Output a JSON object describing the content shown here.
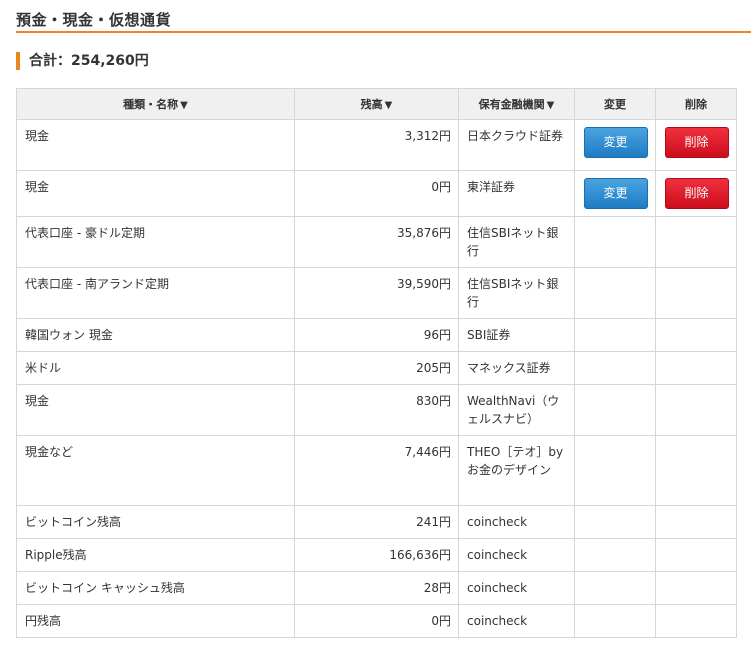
{
  "section": {
    "title": "預金・現金・仮想通貨"
  },
  "total": {
    "label": "合計：254,260円"
  },
  "table": {
    "headers": {
      "name": "種類・名称",
      "balance": "残高",
      "institution": "保有金融機関",
      "change": "変更",
      "delete": "削除"
    },
    "sort_arrow": "▼",
    "edit_label": "変更",
    "delete_label": "削除",
    "rows": [
      {
        "name": "現金",
        "balance": "3,312円",
        "institution": "日本クラウド証券",
        "editable": true
      },
      {
        "name": "現金",
        "balance": "0円",
        "institution": "東洋証券",
        "editable": true
      },
      {
        "name": "代表口座 - 豪ドル定期",
        "balance": "35,876円",
        "institution": "住信SBIネット銀行",
        "editable": false
      },
      {
        "name": "代表口座 - 南アランド定期",
        "balance": "39,590円",
        "institution": "住信SBIネット銀行",
        "editable": false
      },
      {
        "name": "韓国ウォン 現金",
        "balance": "96円",
        "institution": "SBI証券",
        "editable": false
      },
      {
        "name": "米ドル",
        "balance": "205円",
        "institution": "マネックス証券",
        "editable": false
      },
      {
        "name": "現金",
        "balance": "830円",
        "institution": "WealthNavi（ウェルスナビ）",
        "editable": false
      },
      {
        "name": "現金など",
        "balance": "7,446円",
        "institution": "THEO［テオ］by お金のデザイン",
        "editable": false
      },
      {
        "name": "ビットコイン残高",
        "balance": "241円",
        "institution": "coincheck",
        "editable": false
      },
      {
        "name": "Ripple残高",
        "balance": "166,636円",
        "institution": "coincheck",
        "editable": false
      },
      {
        "name": "ビットコイン キャッシュ残高",
        "balance": "28円",
        "institution": "coincheck",
        "editable": false
      },
      {
        "name": "円残高",
        "balance": "0円",
        "institution": "coincheck",
        "editable": false
      }
    ]
  }
}
